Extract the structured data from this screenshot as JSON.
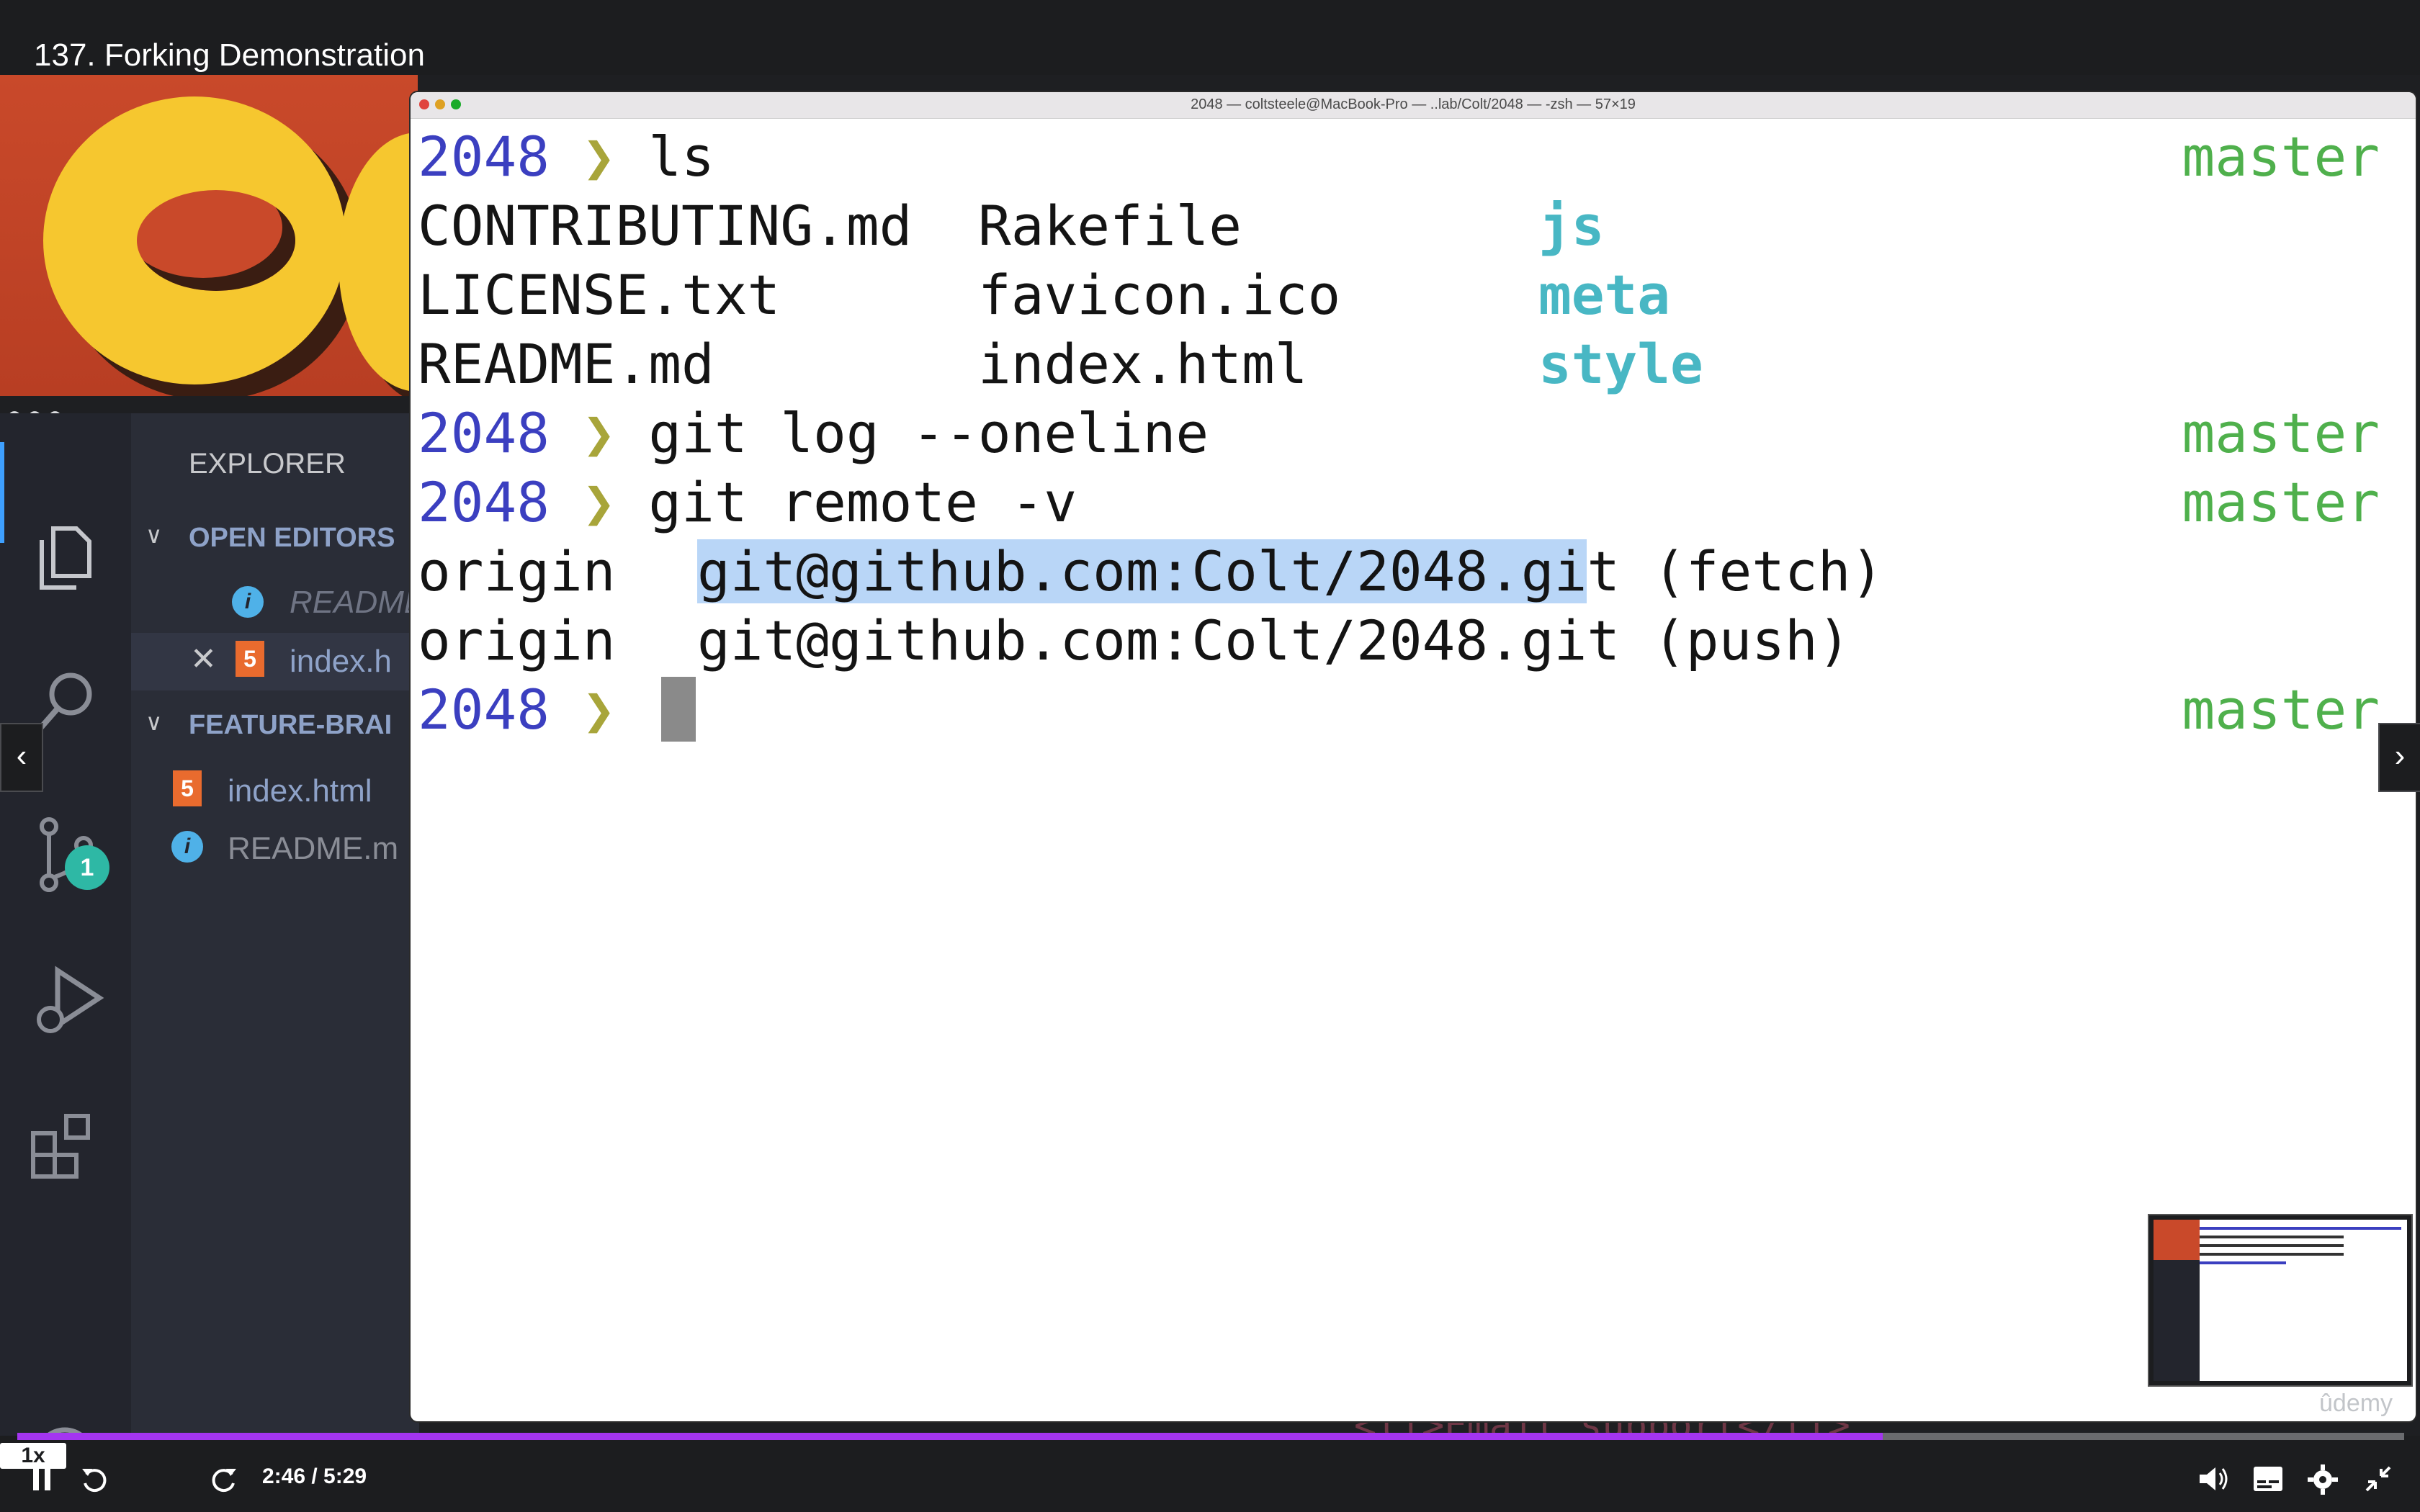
{
  "header": {
    "lecture_title": "137. Forking Demonstration"
  },
  "terminal": {
    "window_title": "2048 — coltsteele@MacBook-Pro — ..lab/Colt/2048 — -zsh — 57×19",
    "prompt_dir": "2048",
    "prompt_arrow": "❯",
    "branch": "master",
    "commands": [
      "ls",
      "git log --oneline",
      "git remote -v"
    ],
    "ls_output": [
      [
        "CONTRIBUTING.md",
        "Rakefile",
        "js"
      ],
      [
        "LICENSE.txt",
        "favicon.ico",
        "meta"
      ],
      [
        "README.md",
        "index.html",
        "style"
      ]
    ],
    "remote_output": {
      "fetch_name": "origin",
      "fetch_url_selected": "git@github.com:Colt/2048.gi",
      "fetch_url_rest": "t",
      "fetch_suffix": "(fetch)",
      "push_name": "origin",
      "push_url": "git@github.com:Colt/2048.git",
      "push_suffix": "(push)"
    }
  },
  "vscode": {
    "explorer_title": "EXPLORER",
    "open_editors_section": "OPEN EDITORS",
    "open_editors": [
      "README",
      "index.h"
    ],
    "feature_section": "FEATURE-BRAI",
    "files": [
      "index.html",
      "README.m"
    ],
    "scm_badge": "1"
  },
  "background_code": "<li>Email support</li>",
  "watermark": "ûdemy",
  "player": {
    "speed": "1x",
    "time": "2:46 / 5:29",
    "progress": 0.7816,
    "accent_color": "#a435f0"
  }
}
